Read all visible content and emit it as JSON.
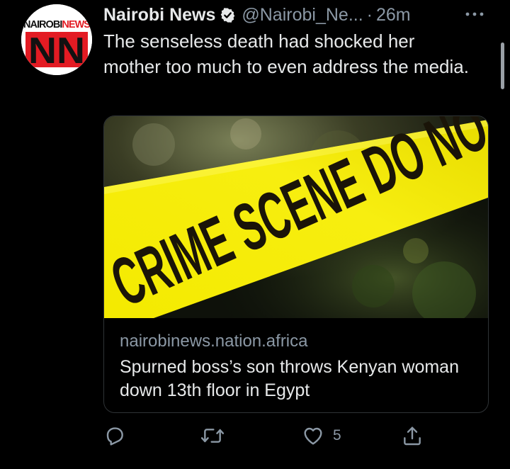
{
  "tweet": {
    "author": {
      "name": "Nairobi News",
      "handle": "@Nairobi_Ne...",
      "verified_icon": "verified-badge-icon",
      "avatar_logo_text": "NAIROBINEWS",
      "avatar_monogram": "NN"
    },
    "separator": "·",
    "time": "26m",
    "more_icon": "ellipsis-icon",
    "text": "The senseless death had shocked her mother too much to even address the media.",
    "card": {
      "image_description": "crime-scene-tape-photo",
      "tape_text": "CRIME SCENE DO NOT",
      "domain": "nairobinews.nation.africa",
      "title": "Spurned boss’s son throws Kenyan woman down 13th floor in Egypt"
    },
    "actions": {
      "reply_icon": "reply-icon",
      "retweet_icon": "retweet-icon",
      "like_icon": "heart-icon",
      "like_count": "5",
      "share_icon": "share-icon"
    }
  },
  "colors": {
    "background": "#000000",
    "text_primary": "#e7e9ea",
    "text_secondary": "#8b98a5",
    "card_border": "#2f3336",
    "brand_red": "#e31b23",
    "tape_yellow": "#f2e600"
  }
}
